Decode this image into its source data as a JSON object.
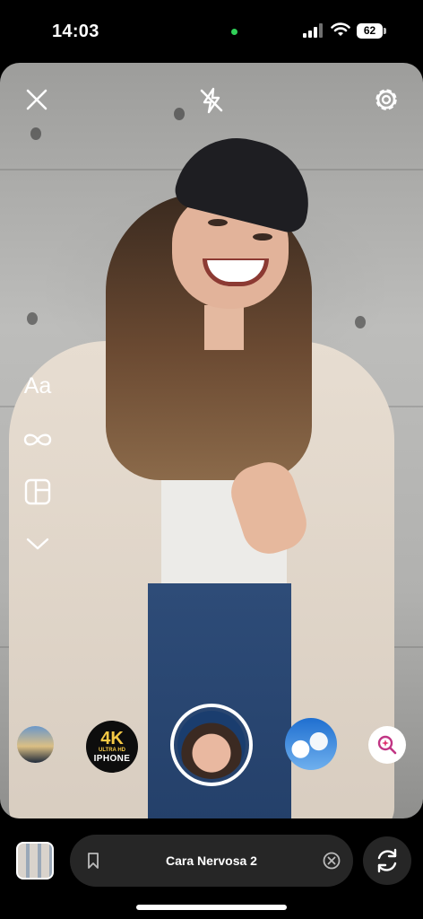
{
  "status_bar": {
    "time": "14:03",
    "battery": "62",
    "indicator_color": "#30d158"
  },
  "camera": {
    "top_controls": {
      "close_icon": "close-icon",
      "flash_icon": "flash-off-icon",
      "settings_icon": "settings-gear-icon"
    },
    "left_tools": [
      {
        "name": "text-tool",
        "label": "Aa"
      },
      {
        "name": "boomerang-tool",
        "icon": "infinity-icon"
      },
      {
        "name": "layout-tool",
        "icon": "layout-grid-icon"
      },
      {
        "name": "more-tools",
        "icon": "chevron-down-icon"
      }
    ],
    "effects": [
      {
        "name": "effect-city"
      },
      {
        "name": "effect-4k-iphone",
        "line1": "4K",
        "line2": "ULTRA HD",
        "line3": "IPHONE"
      },
      {
        "name": "effect-selected-cartoon"
      },
      {
        "name": "effect-clouds"
      }
    ],
    "search_effects_icon": "search-sparkle-icon"
  },
  "bottom_bar": {
    "effect_name": "Cara Nervosa 2",
    "save_icon": "bookmark-icon",
    "clear_icon": "clear-circle-icon",
    "flip_icon": "flip-camera-icon"
  }
}
